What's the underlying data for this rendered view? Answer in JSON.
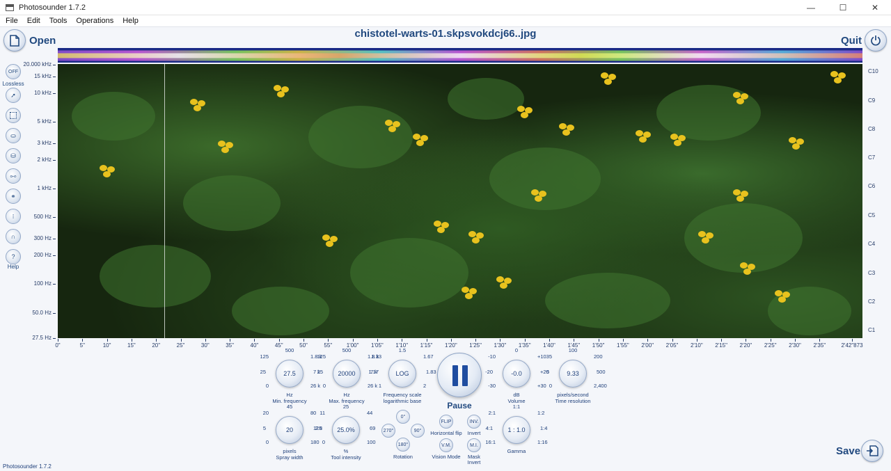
{
  "window": {
    "title": "Photosounder 1.7.2",
    "min": "—",
    "max": "☐",
    "close": "✕"
  },
  "menu": [
    "File",
    "Edit",
    "Tools",
    "Operations",
    "Help"
  ],
  "header": {
    "open_label": "Open",
    "quit_label": "Quit",
    "file_name": "chistotel-warts-01.skpsvokdcj66..jpg",
    "save_label": "Save"
  },
  "tools": {
    "lossless_btn": "OFF",
    "lossless_label": "Lossless",
    "help_btn": "?",
    "help_label": "Help"
  },
  "freq_labels": [
    "20.000 kHz",
    "15 kHz",
    "10 kHz",
    "5 kHz",
    "3 kHz",
    "2 kHz",
    "1 kHz",
    "500 Hz",
    "300 Hz",
    "200 Hz",
    "100 Hz",
    "50.0 Hz",
    "27.5 Hz"
  ],
  "note_labels": [
    "C10",
    "C9",
    "C8",
    "C7",
    "C6",
    "C5",
    "C4",
    "C3",
    "C2",
    "C1"
  ],
  "time_labels": [
    "0\"",
    "5\"",
    "10\"",
    "15\"",
    "20\"",
    "25\"",
    "30\"",
    "35\"",
    "40\"",
    "45\"",
    "50\"",
    "55\"",
    "1'00\"",
    "1'05\"",
    "1'10\"",
    "1'15\"",
    "1'20\"",
    "1'25\"",
    "1'30\"",
    "1'35\"",
    "1'40\"",
    "1'45\"",
    "1'50\"",
    "1'55\"",
    "2'00\"",
    "2'05\"",
    "2'10\"",
    "2'15\"",
    "2'20\"",
    "2'25\"",
    "2'30\"",
    "2'35\"",
    "2'42\"873"
  ],
  "knobs": {
    "minfreq": {
      "value": "27.5",
      "unit": "Hz",
      "caption": "Min. frequency",
      "ticks": [
        "500",
        "125",
        "1.8 k",
        "25",
        "7 k",
        "0",
        "26 k"
      ]
    },
    "maxfreq": {
      "value": "20000",
      "unit": "Hz",
      "caption": "Max. frequency",
      "ticks": [
        "500",
        "125",
        "1.8 k",
        "25",
        "7 k",
        "0",
        "26 k"
      ]
    },
    "freqscale": {
      "value": "LOG",
      "caption1": "Frequency scale",
      "caption2": "logarithmic base",
      "ticks": [
        "1.5",
        "1.33",
        "1.67",
        "1.17",
        "1.83",
        "1",
        "2"
      ]
    },
    "volume": {
      "value": "-0.0",
      "unit": "dB",
      "caption": "Volume",
      "ticks": [
        "0",
        "-10",
        "+10",
        "-20",
        "+20",
        "-30",
        "+30"
      ]
    },
    "timeres": {
      "value": "9.33",
      "unit": "pixels/second",
      "caption": "Time resolution",
      "ticks": [
        "100",
        "35",
        "200",
        "5",
        "500",
        "0",
        "2,400"
      ]
    },
    "spray": {
      "value": "20",
      "unit": "pixels",
      "caption": "Spray width",
      "ticks": [
        "45",
        "20",
        "80",
        "5",
        "125",
        "0",
        "180"
      ]
    },
    "intensity": {
      "value": "25.0%",
      "unit": "%",
      "caption": "Tool intensity",
      "ticks": [
        "25",
        "11",
        "44",
        "2.8",
        "69",
        "0",
        "100"
      ]
    },
    "gamma": {
      "value": "1 : 1.0",
      "caption": "Gamma",
      "ticks": [
        "1:1",
        "2:1",
        "1:2",
        "4:1",
        "1:4",
        "16:1",
        "1:16"
      ]
    }
  },
  "rotation": {
    "caption": "Rotation",
    "r0": "0°",
    "r90": "90°",
    "r180": "180°",
    "r270": "270°"
  },
  "pause_label": "Pause",
  "flip": {
    "btn": "FLIP",
    "caption": "Horizontal flip"
  },
  "inv": {
    "btn": "INV.",
    "caption": "Invert"
  },
  "vm": {
    "btn": "V.M.",
    "caption": "Vision Mode"
  },
  "mi": {
    "btn": "M.I.",
    "caption1": "Mask",
    "caption2": "Invert"
  },
  "status": "Photosounder 1.7.2",
  "colors": {
    "accent": "#21497f",
    "waveform_bg": "#1a2a86",
    "flower": "#e8c21e"
  }
}
